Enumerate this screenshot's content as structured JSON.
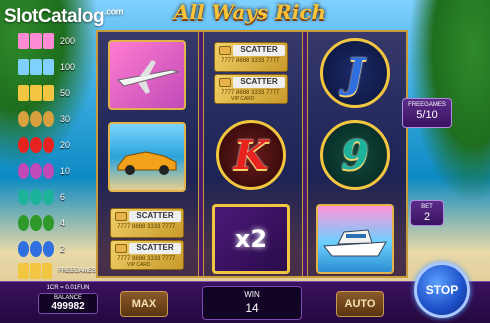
{
  "header": {
    "logo_slot": "Slot",
    "logo_catalog": "Catalog",
    "logo_com": ".com",
    "title": "All Ways Rich"
  },
  "paytable": {
    "rows": [
      {
        "value": "200",
        "colors": [
          "#ff8ad6",
          "#ff8ad6",
          "#ff8ad6"
        ]
      },
      {
        "value": "100",
        "colors": [
          "#7fd0ff",
          "#7fd0ff",
          "#7fd0ff"
        ]
      },
      {
        "value": "50",
        "colors": [
          "#f2c640",
          "#f2c640",
          "#f2c640"
        ]
      },
      {
        "value": "30",
        "colors": [
          "#d9a040",
          "#d9a040",
          "#d9a040"
        ]
      },
      {
        "value": "20",
        "colors": [
          "#e8231f",
          "#e8231f",
          "#e8231f"
        ]
      },
      {
        "value": "10",
        "colors": [
          "#c04bb8",
          "#c04bb8",
          "#c04bb8"
        ]
      },
      {
        "value": "6",
        "colors": [
          "#1cb39a",
          "#1cb39a",
          "#1cb39a"
        ]
      },
      {
        "value": "4",
        "colors": [
          "#2f9a2a",
          "#2f9a2a",
          "#2f9a2a"
        ]
      },
      {
        "value": "2",
        "colors": [
          "#2f6fe0",
          "#2f6fe0",
          "#2f6fe0"
        ]
      }
    ],
    "freegames_label": "FREEGAMES"
  },
  "reels": {
    "scatter_label": "SCATTER",
    "card_number": "7777 8888 3333 7777",
    "vip_label": "VIP CARD",
    "multiplier": "x2",
    "letters": {
      "j": "J",
      "k": "K",
      "n9": "9"
    }
  },
  "side_panels": {
    "freegames_caption": "FREEGAMES",
    "freegames_value": "5/10",
    "bet_caption": "BET",
    "bet_value": "2"
  },
  "bottom_bar": {
    "credit_rate": "1CR = 0.01FUN",
    "balance_caption": "BALANCE",
    "balance_value": "499982",
    "max_label": "MAX",
    "win_caption": "WIN",
    "win_value": "14",
    "auto_label": "AUTO",
    "stop_label": "STOP"
  }
}
